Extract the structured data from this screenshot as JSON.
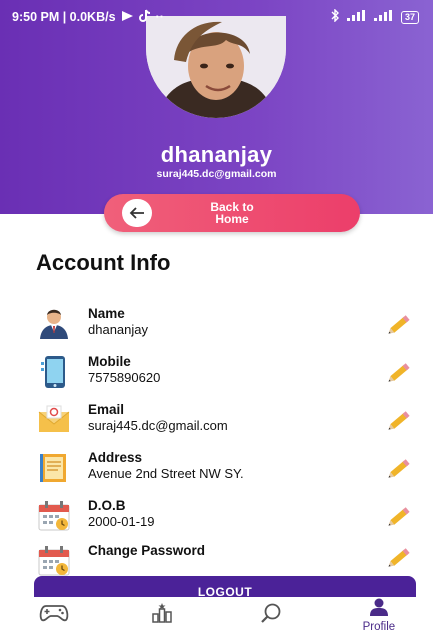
{
  "status_bar": {
    "time_info": "9:50 PM | 0.0KB/s",
    "extras": "··",
    "battery": "37"
  },
  "profile": {
    "name": "dhananjay",
    "email": "suraj445.dc@gmail.com"
  },
  "back_button": {
    "line1": "Back to",
    "line2": "Home"
  },
  "section_title": "Account Info",
  "rows": [
    {
      "label": "Name",
      "value": "dhananjay",
      "icon": "person-icon"
    },
    {
      "label": "Mobile",
      "value": "7575890620",
      "icon": "phone-icon"
    },
    {
      "label": "Email",
      "value": "suraj445.dc@gmail.com",
      "icon": "envelope-icon"
    },
    {
      "label": "Address",
      "value": "Avenue 2nd Street NW SY.",
      "icon": "notebook-icon"
    },
    {
      "label": "D.O.B",
      "value": "2000-01-19",
      "icon": "calendar-icon"
    },
    {
      "label": "Change Password",
      "value": "",
      "icon": "calendar-icon"
    }
  ],
  "logout_label": "LOGOUT",
  "nav": {
    "profile_label": "Profile"
  },
  "colors": {
    "header": "#6a2fb4",
    "accent": "#ec3e6a",
    "logout": "#4b2298",
    "nav_active": "#4a2a88"
  }
}
